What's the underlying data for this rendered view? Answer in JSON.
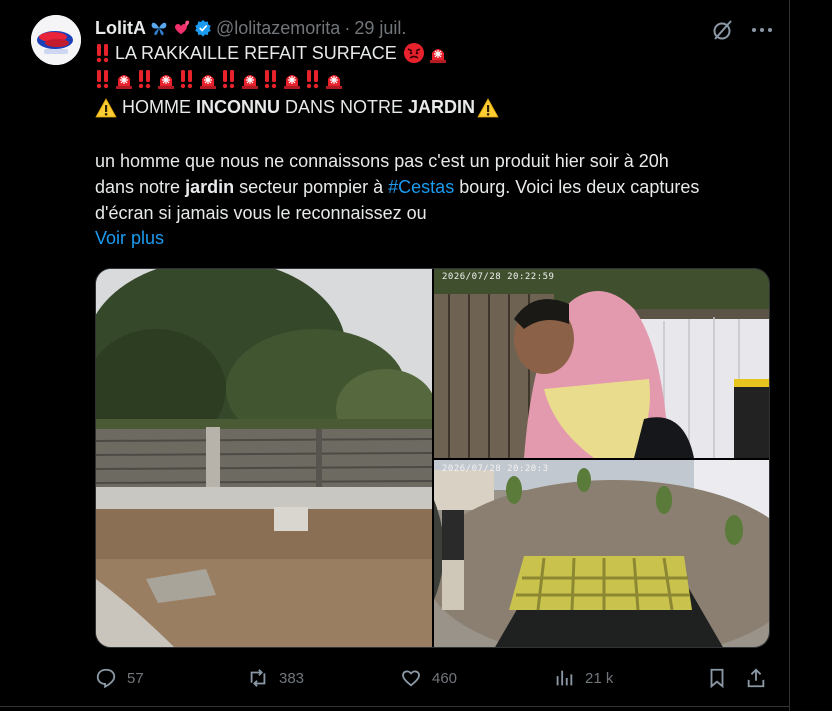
{
  "author": {
    "name": "LolitA",
    "handle": "@lolitazemorita",
    "separator": "·",
    "date": "29 juil.",
    "verified": true
  },
  "post": {
    "line1_text": "LA RAKKAILLE REFAIT SURFACE",
    "line3": {
      "pre": "HOMME ",
      "bold1": "INCONNU",
      "mid": " DANS NOTRE ",
      "bold2": "JARDIN"
    },
    "body_line1": "un homme que nous ne connaissons pas c'est un produit hier soir à 20h",
    "body_line2_pre": "dans notre ",
    "body_line2_bold": "jardin",
    "body_line2_mid": " secteur pompier à ",
    "body_line2_hashtag": "#Cestas",
    "body_line2_post": " bourg. Voici les deux captures",
    "body_line3": "d'écran si jamais vous le reconnaissez ou",
    "show_more": "Voir plus"
  },
  "media": {
    "timestamp_1": "2026/07/28 20:22:59",
    "timestamp_2": "2026/07/28 20:20:3"
  },
  "actions": {
    "replies": "57",
    "reposts": "383",
    "likes": "460",
    "views": "21 k"
  },
  "icons": {
    "reply": "reply-icon",
    "repost": "repost-icon",
    "like": "heart-icon",
    "views": "views-icon",
    "bookmark": "bookmark-icon",
    "share": "share-icon",
    "grok": "grok-icon",
    "more": "more-icon"
  },
  "colors": {
    "background": "#000000",
    "text": "#e7e9ea",
    "muted": "#71767b",
    "link": "#1d9bf0",
    "alert_red": "#e8222c",
    "warning_yellow": "#ffcc33"
  }
}
